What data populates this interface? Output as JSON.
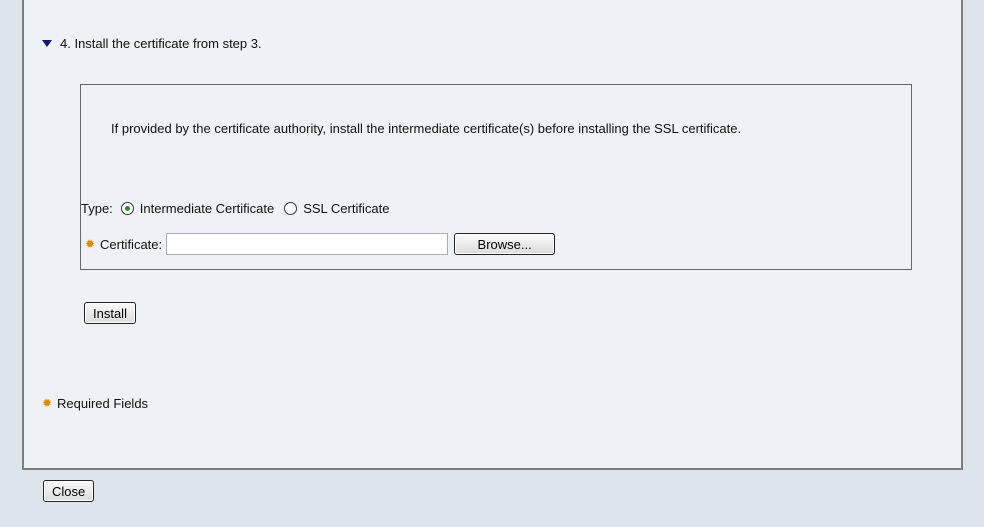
{
  "step": {
    "title": "4. Install the certificate from step 3."
  },
  "info": {
    "text": "If provided by the certificate authority, install the intermediate certificate(s) before installing the SSL certificate."
  },
  "type_field": {
    "label": "Type:",
    "options": [
      {
        "label": "Intermediate Certificate",
        "selected": true
      },
      {
        "label": "SSL Certificate",
        "selected": false
      }
    ]
  },
  "certificate_field": {
    "label": "Certificate:",
    "value": "",
    "browse_label": "Browse...",
    "required_icon": "asterisk-icon"
  },
  "actions": {
    "install_label": "Install",
    "close_label": "Close"
  },
  "footer": {
    "required_note": "Required Fields"
  },
  "colors": {
    "accent": "#e08a00",
    "triangle": "#0d1a6e",
    "radio_selected": "#2e8b2e"
  }
}
